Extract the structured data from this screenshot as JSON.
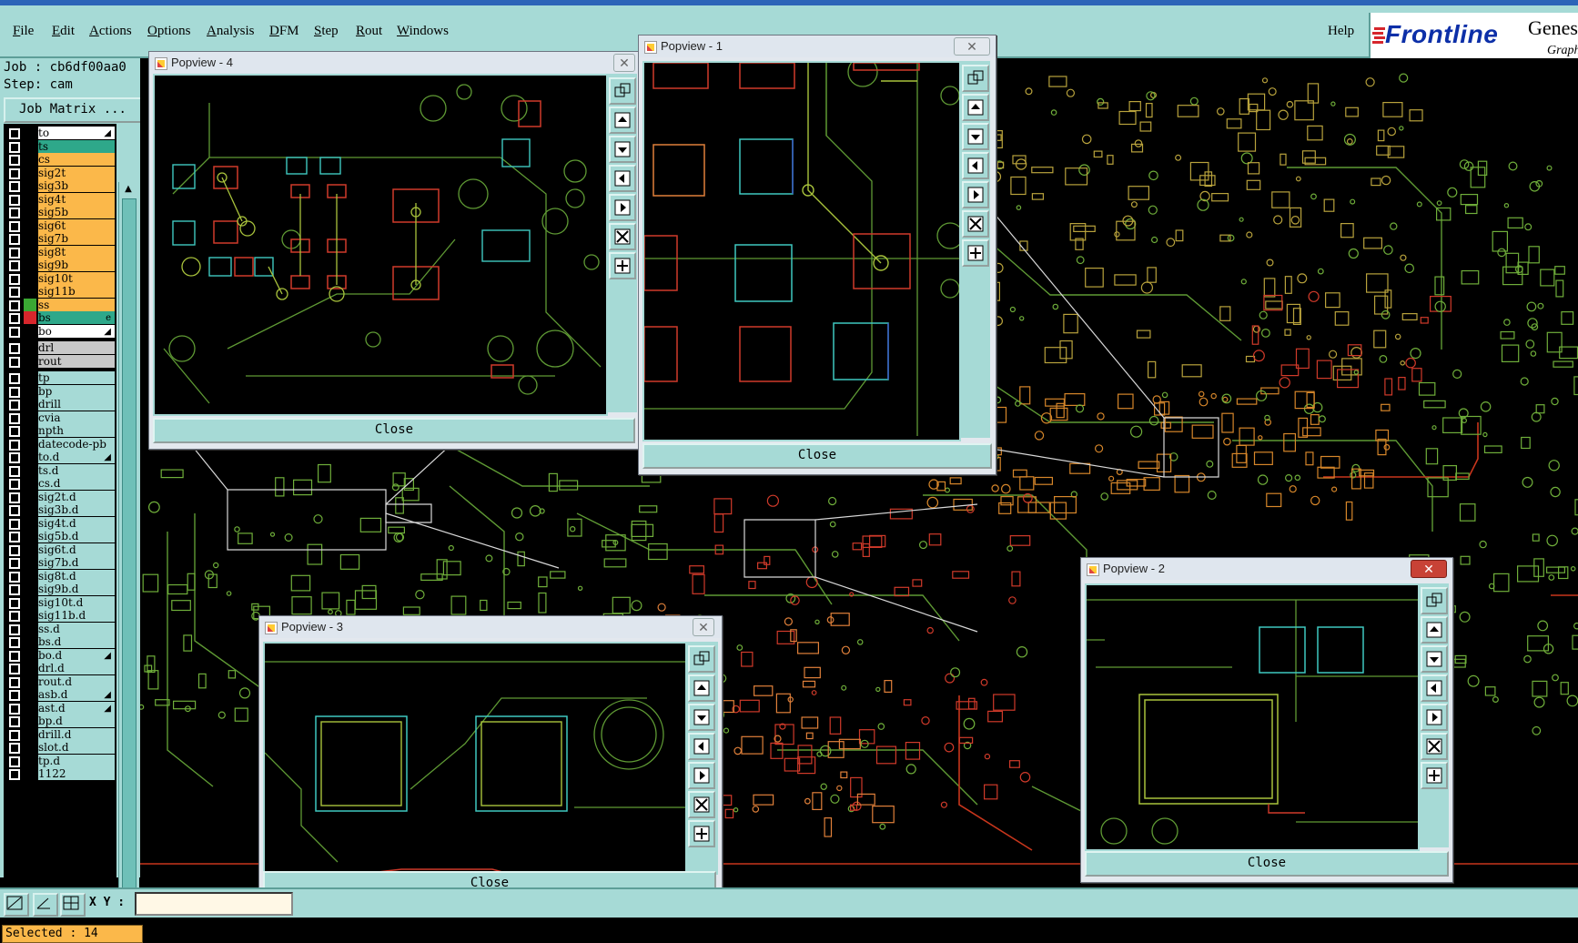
{
  "menu": {
    "items": [
      "File",
      "Edit",
      "Actions",
      "Options",
      "Analysis",
      "DFM",
      "Step",
      "Rout",
      "Windows"
    ],
    "help": "Help"
  },
  "brand": {
    "name": "Frontline",
    "product": "Genes",
    "tagline": "Graph"
  },
  "job": {
    "job_line": "Job : cb6df00aa0",
    "step_line": "Step: cam",
    "matrix_button": "Job Matrix ..."
  },
  "layers": [
    {
      "name": "to",
      "color": "#ffffff",
      "mark": "◢"
    },
    {
      "name": "ts",
      "color": "#2ea88a"
    },
    {
      "name": "cs",
      "color": "#fbb84a"
    },
    {
      "name": "sig2t",
      "color": "#fbb84a"
    },
    {
      "name": "sig3b",
      "color": "#fbb84a"
    },
    {
      "name": "sig4t",
      "color": "#fbb84a"
    },
    {
      "name": "sig5b",
      "color": "#fbb84a"
    },
    {
      "name": "sig6t",
      "color": "#fbb84a"
    },
    {
      "name": "sig7b",
      "color": "#fbb84a"
    },
    {
      "name": "sig8t",
      "color": "#fbb84a"
    },
    {
      "name": "sig9b",
      "color": "#fbb84a"
    },
    {
      "name": "sig10t",
      "color": "#fbb84a"
    },
    {
      "name": "sig11b",
      "color": "#fbb84a"
    },
    {
      "name": "ss",
      "color": "#fbb84a",
      "swatch": "#3aa833"
    },
    {
      "name": "bs",
      "color": "#2ea88a",
      "swatch": "#d6262c",
      "mark": "e"
    },
    {
      "name": "bo",
      "color": "#ffffff",
      "mark": "◢"
    },
    {
      "name": "drl",
      "color": "#c8c8c8",
      "gap": true
    },
    {
      "name": "rout",
      "color": "#c8c8c8"
    },
    {
      "name": "tp",
      "color": "#a6dad6",
      "gap": true
    },
    {
      "name": "bp",
      "color": "#a6dad6"
    },
    {
      "name": "drill",
      "color": "#a6dad6"
    },
    {
      "name": "cvia",
      "color": "#a6dad6"
    },
    {
      "name": "npth",
      "color": "#a6dad6"
    },
    {
      "name": "datecode-pb",
      "color": "#a6dad6"
    },
    {
      "name": "to.d",
      "color": "#a6dad6",
      "mark": "◢"
    },
    {
      "name": "ts.d",
      "color": "#a6dad6"
    },
    {
      "name": "cs.d",
      "color": "#a6dad6"
    },
    {
      "name": "sig2t.d",
      "color": "#a6dad6"
    },
    {
      "name": "sig3b.d",
      "color": "#a6dad6"
    },
    {
      "name": "sig4t.d",
      "color": "#a6dad6"
    },
    {
      "name": "sig5b.d",
      "color": "#a6dad6"
    },
    {
      "name": "sig6t.d",
      "color": "#a6dad6"
    },
    {
      "name": "sig7b.d",
      "color": "#a6dad6"
    },
    {
      "name": "sig8t.d",
      "color": "#a6dad6"
    },
    {
      "name": "sig9b.d",
      "color": "#a6dad6"
    },
    {
      "name": "sig10t.d",
      "color": "#a6dad6"
    },
    {
      "name": "sig11b.d",
      "color": "#a6dad6"
    },
    {
      "name": "ss.d",
      "color": "#a6dad6"
    },
    {
      "name": "bs.d",
      "color": "#a6dad6"
    },
    {
      "name": "bo.d",
      "color": "#a6dad6",
      "mark": "◢"
    },
    {
      "name": "drl.d",
      "color": "#a6dad6"
    },
    {
      "name": "rout.d",
      "color": "#a6dad6"
    },
    {
      "name": "asb.d",
      "color": "#a6dad6",
      "mark": "◢"
    },
    {
      "name": "ast.d",
      "color": "#a6dad6",
      "mark": "◢"
    },
    {
      "name": "bp.d",
      "color": "#a6dad6"
    },
    {
      "name": "drill.d",
      "color": "#a6dad6"
    },
    {
      "name": "slot.d",
      "color": "#a6dad6"
    },
    {
      "name": "tp.d",
      "color": "#a6dad6"
    },
    {
      "name": "1122",
      "color": "#a6dad6"
    }
  ],
  "status": {
    "selected": "Selected : 14",
    "xy_label": "X Y :"
  },
  "popviews": {
    "p1": {
      "title": "Popview - 1",
      "close": "Close"
    },
    "p2": {
      "title": "Popview - 2",
      "close": "Close"
    },
    "p3": {
      "title": "Popview - 3",
      "close": "Close"
    },
    "p4": {
      "title": "Popview - 4",
      "close": "Close"
    }
  },
  "colors": {
    "panel": "#a6dad6",
    "copper": "#fbb84a",
    "trace_green": "#6fae3a",
    "trace_red": "#d03a2a",
    "pad_cyan": "#3fc8c0"
  }
}
